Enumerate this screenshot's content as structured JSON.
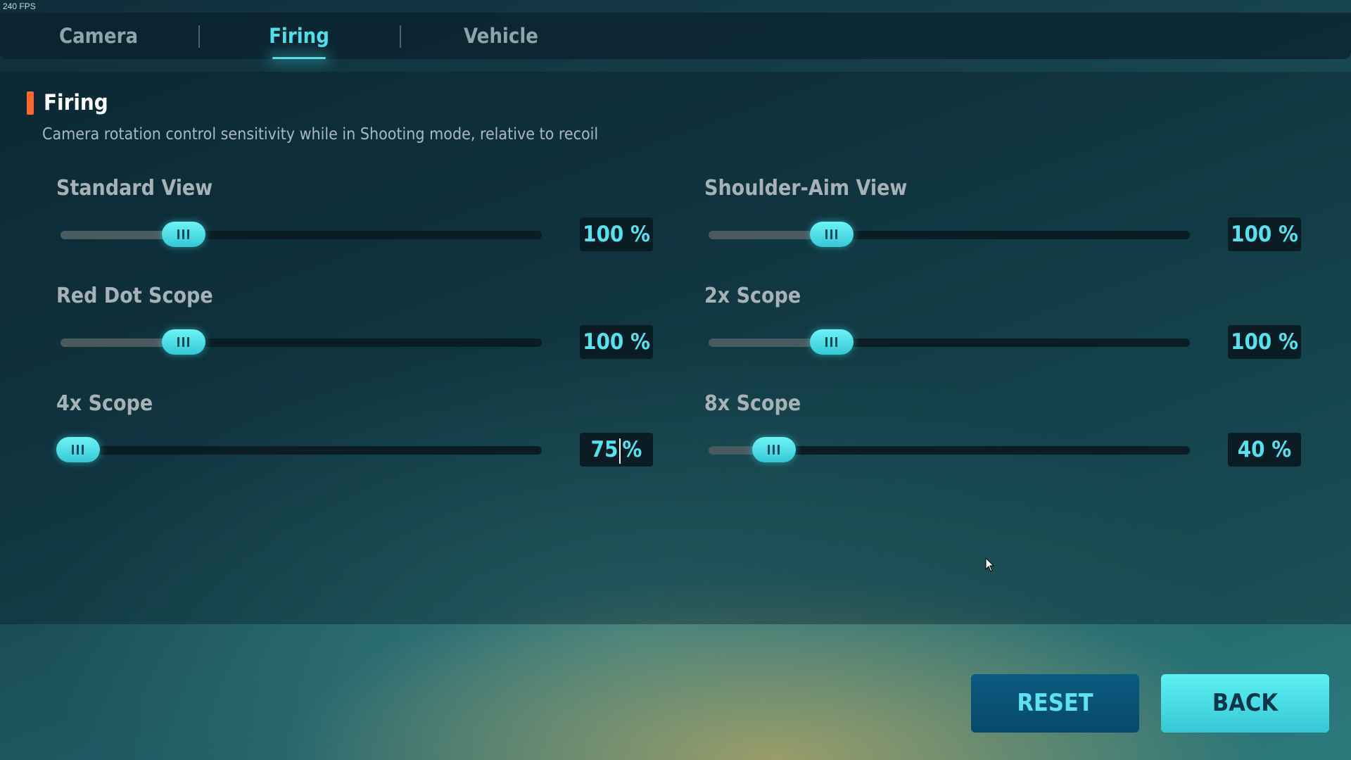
{
  "fps": "240 FPS",
  "tabs": [
    {
      "label": "Camera",
      "active": false
    },
    {
      "label": "Firing",
      "active": true
    },
    {
      "label": "Vehicle",
      "active": false
    }
  ],
  "section": {
    "title": "Firing",
    "description": "Camera rotation control sensitivity while in Shooting mode, relative to recoil"
  },
  "settings": [
    {
      "label": "Standard View",
      "value": "100",
      "unit": "%",
      "fraction": 0.21
    },
    {
      "label": "Shoulder-Aim View",
      "value": "100",
      "unit": "%",
      "fraction": 0.21
    },
    {
      "label": "Red Dot Scope",
      "value": "100",
      "unit": "%",
      "fraction": 0.21
    },
    {
      "label": "2x Scope",
      "value": "100",
      "unit": "%",
      "fraction": 0.21
    },
    {
      "label": "4x Scope",
      "value": "75",
      "unit": "%",
      "fraction": 0.0,
      "editing": true
    },
    {
      "label": "8x Scope",
      "value": "40",
      "unit": "%",
      "fraction": 0.09
    }
  ],
  "buttons": {
    "reset": "RESET",
    "back": "BACK"
  },
  "colors": {
    "accent": "#4ee0e8",
    "marker": "#ff6a2b",
    "reset_bg": "#0b5a80",
    "back_bg": "#5ff0f4"
  }
}
